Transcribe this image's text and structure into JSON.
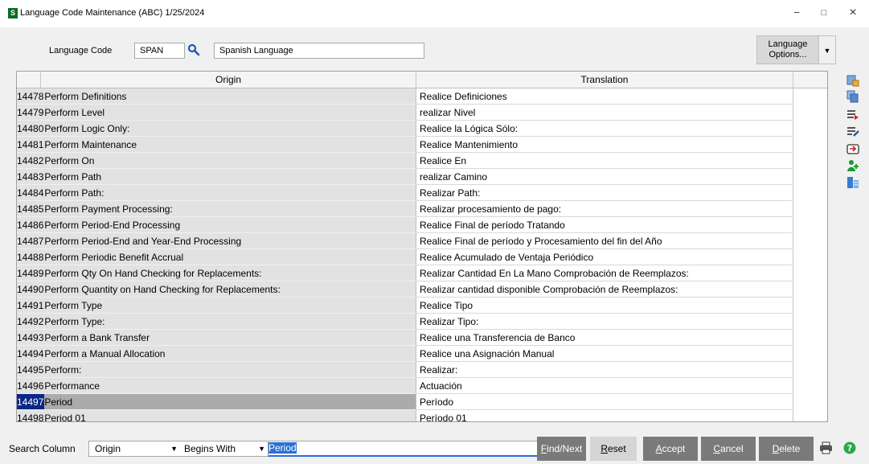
{
  "window": {
    "title": "Language Code Maintenance (ABC) 1/25/2024",
    "app_icon_letter": "S",
    "minimize": "−",
    "maximize": "□",
    "close": "×"
  },
  "header": {
    "language_code_label": "Language Code",
    "language_code_value": "SPAN",
    "language_desc_value": "Spanish Language",
    "lang_options_line1": "Language",
    "lang_options_line2": "Options..."
  },
  "grid": {
    "columns": [
      "Origin",
      "Translation"
    ],
    "rows": [
      {
        "num": "14478",
        "origin": "Perform Definitions",
        "translation": "Realice Definiciones"
      },
      {
        "num": "14479",
        "origin": "Perform Level",
        "translation": "realizar Nivel"
      },
      {
        "num": "14480",
        "origin": "Perform Logic Only:",
        "translation": "Realice la Lógica Sólo:"
      },
      {
        "num": "14481",
        "origin": "Perform Maintenance",
        "translation": "Realice Mantenimiento"
      },
      {
        "num": "14482",
        "origin": "Perform On",
        "translation": "Realice En"
      },
      {
        "num": "14483",
        "origin": "Perform Path",
        "translation": "realizar Camino"
      },
      {
        "num": "14484",
        "origin": "Perform Path:",
        "translation": "Realizar Path:"
      },
      {
        "num": "14485",
        "origin": "Perform Payment Processing:",
        "translation": "Realizar procesamiento de pago:"
      },
      {
        "num": "14486",
        "origin": "Perform Period-End Processing",
        "translation": "Realice Final de período Tratando"
      },
      {
        "num": "14487",
        "origin": "Perform Period-End and Year-End Processing",
        "translation": "Realice Final de período y Procesamiento del fin del Año"
      },
      {
        "num": "14488",
        "origin": "Perform Periodic Benefit Accrual",
        "translation": "Realice Acumulado de Ventaja Periódico"
      },
      {
        "num": "14489",
        "origin": "Perform Qty On Hand Checking for Replacements:",
        "translation": "Realizar Cantidad En La Mano Comprobación de Reemplazos:"
      },
      {
        "num": "14490",
        "origin": "Perform Quantity on Hand Checking for Replacements:",
        "translation": "Realizar cantidad disponible Comprobación de Reemplazos:"
      },
      {
        "num": "14491",
        "origin": "Perform Type",
        "translation": "Realice Tipo"
      },
      {
        "num": "14492",
        "origin": "Perform Type:",
        "translation": "Realizar Tipo:"
      },
      {
        "num": "14493",
        "origin": "Perform a Bank Transfer",
        "translation": "Realice una Transferencia de Banco"
      },
      {
        "num": "14494",
        "origin": "Perform a Manual Allocation",
        "translation": "Realice una Asignación Manual"
      },
      {
        "num": "14495",
        "origin": "Perform:",
        "translation": "Realizar:"
      },
      {
        "num": "14496",
        "origin": "Performance",
        "translation": "Actuación"
      },
      {
        "num": "14497",
        "origin": "Period",
        "translation": "Período"
      },
      {
        "num": "14498",
        "origin": "Period 01",
        "translation": "Período 01"
      }
    ],
    "selected_row_index": 19
  },
  "side_icons": [
    "customize-icon",
    "copy-icon",
    "list-add-icon",
    "list-edit-icon",
    "import-icon",
    "user-add-icon",
    "grid-layout-icon"
  ],
  "search": {
    "label": "Search Column",
    "column_value": "Origin",
    "mode_value": "Begins With",
    "text_value": "Period"
  },
  "buttons": {
    "find_next": {
      "u": "F",
      "rest": "ind/Next"
    },
    "reset": {
      "u": "R",
      "rest": "eset"
    },
    "accept": {
      "u": "A",
      "rest": "ccept"
    },
    "cancel": {
      "u": "C",
      "rest": "ancel"
    },
    "delete": {
      "u": "D",
      "rest": "elete"
    }
  },
  "colors": {
    "selection_num": "#0a2686",
    "search_highlight": "#2a6fd6",
    "dark_button": "#7a7a7a",
    "help_icon": "#2aa84a"
  }
}
